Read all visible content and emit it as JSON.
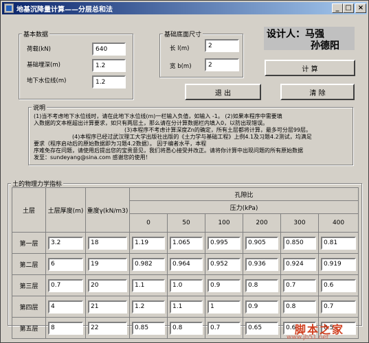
{
  "window": {
    "title": "地基沉降量计算——分层总和法",
    "controls": {
      "minimize": "_",
      "maximize": "□",
      "close": "×"
    }
  },
  "basic_data": {
    "group_label": "基本数据",
    "fields": [
      {
        "label": "荷载(kN)",
        "value": "640"
      },
      {
        "label": "基础埋深(m)",
        "value": "1.2"
      },
      {
        "label": "地下水位线(m)",
        "value": "1.2"
      }
    ]
  },
  "foundation_size": {
    "group_label": "基础底面尺寸",
    "fields": [
      {
        "label": "长 l(m)",
        "value": "2"
      },
      {
        "label": "宽 b(m)",
        "value": "2"
      }
    ]
  },
  "designer": {
    "line1": "设计人：马强",
    "line2": "孙德阳"
  },
  "buttons": {
    "compute": "计  算",
    "exit": "退  出",
    "clear": "清  除"
  },
  "notes": {
    "group_label": "说明",
    "lines": [
      "(1)当不考虑地下水位线时，请在此地下水位线(m)一栏输入负值，如输入 -1。    (2)如果本程序中需要填",
      "入数据的文本框超出计算要求，如只有两层土，那么请在分计算数据栏内填入0，以防出现错误。",
      "(3)本程序不考虑计算深度Zn的确定，所有土层都将计算，最多可分层99层。",
      "(4)本程序已经过武汉理工大学出版社出版的《土力学与基础工程》上例4.1及习题4.2测试，均满足",
      "要求（程序启动后的原始数据即为习题4.2数据）。          因于编者水平，本程",
      "序难免存在问题，请使用后提出您的宝贵意见，我们将悉心接受并改正。请将你计算中出现问题的所有原始数据",
      "发至：sundeyang@sina.com                                          感谢您的使用！"
    ]
  },
  "soil": {
    "group_label": "土的物理力学指标",
    "headers": {
      "layer": "土层",
      "thickness": "土层厚度(m)",
      "unit_weight": "重度γ(kN/m3)",
      "void_ratio": "孔隙比",
      "pressure": "压力(kPa)",
      "pressures": [
        "0",
        "50",
        "100",
        "200",
        "300",
        "400"
      ]
    },
    "rows": [
      {
        "name": "第一层",
        "thickness": "3.2",
        "unit_weight": "18",
        "e": [
          "1.19",
          "1.065",
          "0.995",
          "0.905",
          "0.850",
          "0.81"
        ]
      },
      {
        "name": "第二层",
        "thickness": "6",
        "unit_weight": "19",
        "e": [
          "0.982",
          "0.964",
          "0.952",
          "0.936",
          "0.924",
          "0.919"
        ]
      },
      {
        "name": "第三层",
        "thickness": "0.7",
        "unit_weight": "20",
        "e": [
          "1.1",
          "1.0",
          "0.9",
          "0.8",
          "0.7",
          "0.6"
        ]
      },
      {
        "name": "第四层",
        "thickness": "4",
        "unit_weight": "21",
        "e": [
          "1.2",
          "1.1",
          "1",
          "0.9",
          "0.8",
          "0.7"
        ]
      },
      {
        "name": "第五层",
        "thickness": "8",
        "unit_weight": "22",
        "e": [
          "0.85",
          "0.8",
          "0.7",
          "0.65",
          "0.6",
          "0.5"
        ]
      }
    ]
  },
  "watermark": {
    "line1": "脚本之家",
    "line2": "www.jb51.net"
  },
  "colors": {
    "face": "#d4d0c8",
    "title_start": "#0a246a",
    "title_end": "#a6caf0",
    "designer_bg": "#c0c0c0"
  }
}
